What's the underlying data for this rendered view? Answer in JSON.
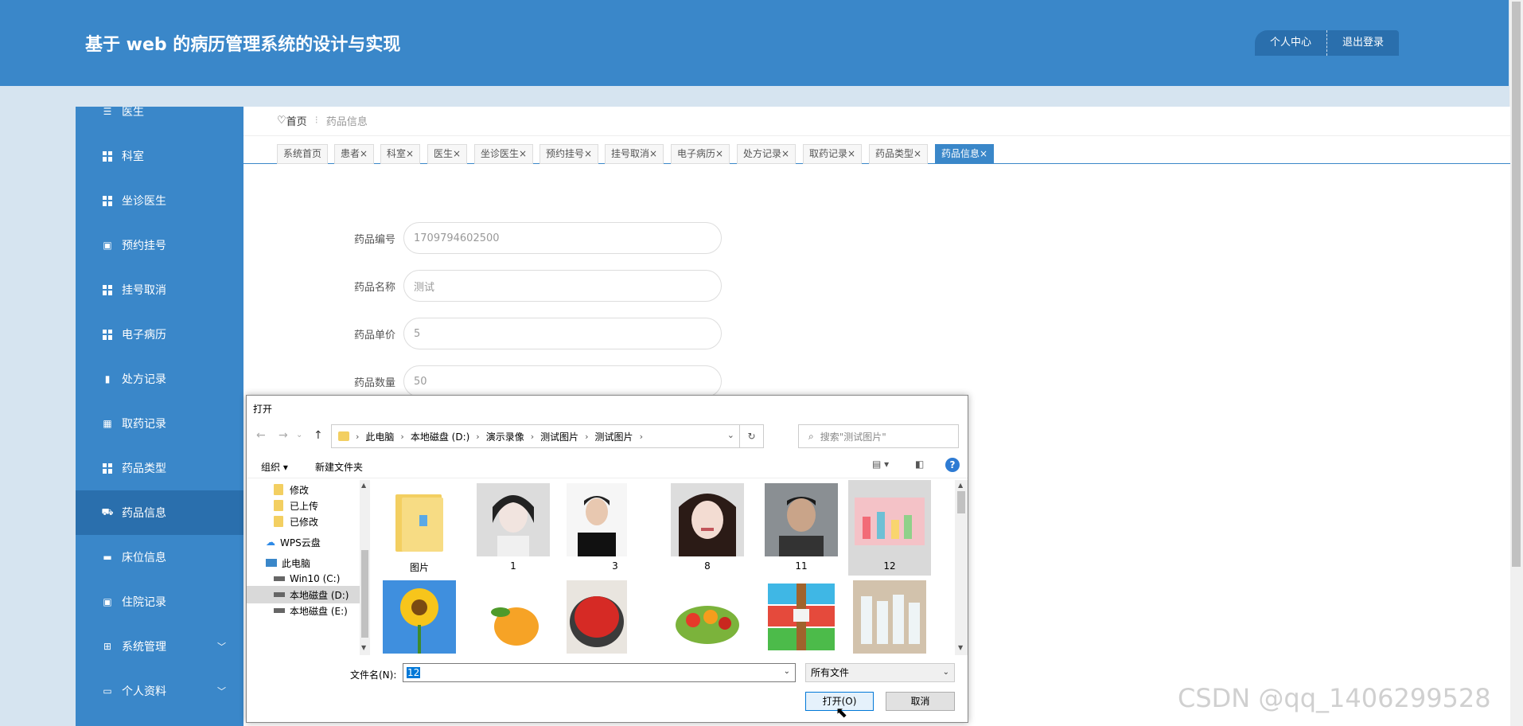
{
  "header": {
    "title": "基于 web 的病历管理系统的设计与实现",
    "btn_profile": "个人中心",
    "btn_logout": "退出登录"
  },
  "sidebar": {
    "items": [
      {
        "label": "医生",
        "icon": "sliders-icon",
        "active": false
      },
      {
        "label": "科室",
        "icon": "grid-icon",
        "active": false
      },
      {
        "label": "坐诊医生",
        "icon": "grid-icon",
        "active": false
      },
      {
        "label": "预约挂号",
        "icon": "clipboard-icon",
        "active": false
      },
      {
        "label": "挂号取消",
        "icon": "grid-icon",
        "active": false
      },
      {
        "label": "电子病历",
        "icon": "grid-icon",
        "active": false
      },
      {
        "label": "处方记录",
        "icon": "bar-chart-icon",
        "active": false
      },
      {
        "label": "取药记录",
        "icon": "table-icon",
        "active": false
      },
      {
        "label": "药品类型",
        "icon": "grid-icon",
        "active": false
      },
      {
        "label": "药品信息",
        "icon": "cart-icon",
        "active": true
      },
      {
        "label": "床位信息",
        "icon": "bed-icon",
        "active": false
      },
      {
        "label": "住院记录",
        "icon": "clipboard-icon",
        "active": false
      },
      {
        "label": "系统管理",
        "icon": "gift-icon",
        "active": false,
        "expandable": true
      },
      {
        "label": "个人资料",
        "icon": "monitor-icon",
        "active": false,
        "expandable": true
      }
    ]
  },
  "breadcrumb": {
    "home": "首页",
    "current": "药品信息"
  },
  "tabs": [
    {
      "label": "系统首页",
      "closable": false
    },
    {
      "label": "患者",
      "closable": true
    },
    {
      "label": "科室",
      "closable": true
    },
    {
      "label": "医生",
      "closable": true
    },
    {
      "label": "坐诊医生",
      "closable": true
    },
    {
      "label": "预约挂号",
      "closable": true
    },
    {
      "label": "挂号取消",
      "closable": true
    },
    {
      "label": "电子病历",
      "closable": true
    },
    {
      "label": "处方记录",
      "closable": true
    },
    {
      "label": "取药记录",
      "closable": true
    },
    {
      "label": "药品类型",
      "closable": true
    },
    {
      "label": "药品信息",
      "closable": true,
      "active": true
    }
  ],
  "form": {
    "fields": [
      {
        "label": "药品编号",
        "value": "1709794602500"
      },
      {
        "label": "药品名称",
        "value": "测试"
      },
      {
        "label": "药品单价",
        "value": "5"
      },
      {
        "label": "药品数量",
        "value": "50"
      }
    ]
  },
  "dialog": {
    "title": "打开",
    "path": [
      "此电脑",
      "本地磁盘 (D:)",
      "演示录像",
      "测试图片",
      "测试图片"
    ],
    "search_placeholder": "搜索\"测试图片\"",
    "toolbar": {
      "organize": "组织 ▾",
      "new_folder": "新建文件夹"
    },
    "nav": [
      {
        "label": "修改",
        "type": "folder"
      },
      {
        "label": "已上传",
        "type": "folder"
      },
      {
        "label": "已修改",
        "type": "folder"
      },
      {
        "label": "WPS云盘",
        "type": "cloud"
      },
      {
        "label": "此电脑",
        "type": "pc"
      },
      {
        "label": "Win10 (C:)",
        "type": "drive"
      },
      {
        "label": "本地磁盘 (D:)",
        "type": "drive",
        "selected": true
      },
      {
        "label": "本地磁盘 (E:)",
        "type": "drive"
      }
    ],
    "files": [
      {
        "name": "图片",
        "kind": "folder"
      },
      {
        "name": "1",
        "kind": "photo-girl"
      },
      {
        "name": "3",
        "kind": "photo-boy"
      },
      {
        "name": "8",
        "kind": "photo-woman"
      },
      {
        "name": "11",
        "kind": "photo-man"
      },
      {
        "name": "12",
        "kind": "photo-bottles",
        "selected": true
      },
      {
        "name": "",
        "kind": "photo-sunflower"
      },
      {
        "name": "",
        "kind": "photo-mango"
      },
      {
        "name": "",
        "kind": "photo-strawberry"
      },
      {
        "name": "",
        "kind": "photo-fruits"
      },
      {
        "name": "",
        "kind": "photo-archive"
      },
      {
        "name": "",
        "kind": "photo-water"
      }
    ],
    "filename_label": "文件名(N):",
    "filename_value": "12",
    "filetype": "所有文件",
    "open_label": "打开(O)",
    "cancel_label": "取消"
  },
  "watermark": "CSDN @qq_1406299528",
  "colors": {
    "primary": "#3a87c9",
    "primary_dark": "#2a6fad",
    "background": "#d6e4f0"
  }
}
